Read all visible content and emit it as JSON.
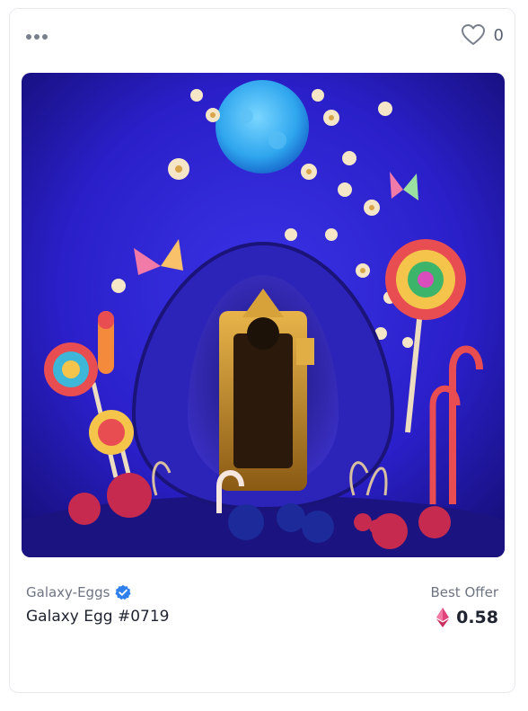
{
  "card": {
    "likes": "0",
    "collection": "Galaxy-Eggs",
    "item_name": "Galaxy Egg #0719",
    "offer_label": "Best Offer",
    "price": "0.58",
    "verified": true
  },
  "colors": {
    "background_blue": "#2a1fd0",
    "eth_pink": "#e0447a",
    "verified_blue": "#2f80ed",
    "text_muted": "#6f7482",
    "text_dark": "#1f2430"
  },
  "icons": {
    "more": "more-horizontal-icon",
    "like": "heart-outline-icon",
    "verified": "verified-badge-icon",
    "currency": "ethereum-icon"
  }
}
